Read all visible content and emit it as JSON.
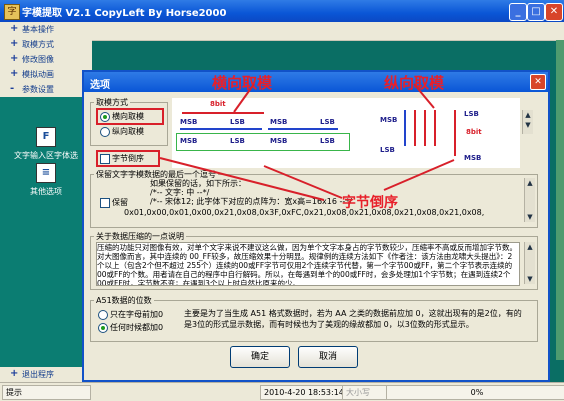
{
  "window": {
    "title": "字模提取 V2.1   CopyLeft By Horse2000",
    "min_label": "_",
    "max_label": "□",
    "close_label": "✕"
  },
  "sidebar": {
    "items": [
      {
        "label": "基本操作"
      },
      {
        "label": "取模方式"
      },
      {
        "label": "修改图像"
      },
      {
        "label": "模拟动画"
      },
      {
        "label": "参数设置"
      }
    ],
    "tools": [
      {
        "label": "文字输入区字体选",
        "icon": "font-icon"
      },
      {
        "label": "其他选项",
        "icon": "document-icon"
      }
    ],
    "exit_label": "退出程序"
  },
  "statusbar": {
    "hint": "提示",
    "datetime": "2010-4-20 18:53:14",
    "caps": "大小写",
    "percent": "0%"
  },
  "dialog": {
    "title": "选项",
    "annot_horizontal": "横向取模",
    "annot_vertical": "纵向取模",
    "annot_byte_reverse": "字节倒序",
    "mode_group": "取模方式",
    "mode_horizontal": "横向取模",
    "mode_vertical": "纵向取模",
    "byte_reverse": "字节倒序",
    "diagram": {
      "bit8_left": "8bit",
      "bit8_right": "8bit",
      "msb": "MSB",
      "lsb": "LSB"
    },
    "keep_group": "保留文字字模数据的最后一个逗号",
    "keep_label": "保留",
    "keep_text": [
      "如果保留的话，如下所示：",
      "/*--  文字:  中  --*/",
      "/*--  宋体12;  此字体下对应的点阵为：宽x高=16x16  --*/",
      "0x01,0x00,0x01,0x00,0x21,0x08,0x3F,0xFC,0x21,0x08,0x21,0x08,0x21,0x08,0x21,0x08,"
    ],
    "compress_group": "关于数据压缩的一点说明",
    "compress_text": "压缩的功能只对图像有效，对单个文字来说不建议这么做，因为单个文字本身占的字节数较少，压缩率不高或反而增加字节数。对大图像而言，其中连续的 00_FF较多，故压缩效果十分明显。规律例的连续方法如下《作者注：该方法由龙啸大头提出》：2个以上（包含2个但不超过 255个）连续的00或FF字节可仅用2个连续字节代替，第一个字节00或FF，第二个字节表示连续的00或FF的个数。用者请在自己的程序中自行解码。所以，在每遇到单个的00或FF时，会多处理加1个字节数；在遇到连续2个00或FF时，字节数不变；在遇到3个以上时自然比原来的少。",
    "a51_group": "A51数据的位数",
    "a51_opt1": "只在字母前加0",
    "a51_opt2": "任何时候都加0",
    "a51_text": "主要是为了当生成 A51 格式数据时，若为 AA 之类的数据前应加 0，这就出现有的是2位，有的是3位的形式显示数据，而有时候也为了美观的缘故都加 0，以3位数的形式显示。",
    "ok_label": "确定",
    "cancel_label": "取消"
  },
  "colors": {
    "annotation_red": "#e8202a",
    "title_blue": "#0a56d6",
    "teal_panel": "#0b7d72"
  }
}
